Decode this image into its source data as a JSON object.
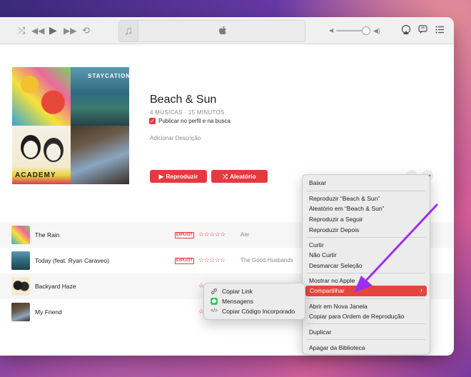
{
  "toolbar": {
    "shuffle_icon": "shuffle-icon",
    "prev_icon": "rewind-icon",
    "play_icon": "play-icon",
    "next_icon": "fast-forward-icon",
    "repeat_icon": "repeat-icon",
    "volume_level": 0.8,
    "airplay_icon": "airplay-icon",
    "lyrics_icon": "lyrics-icon",
    "queue_icon": "list-icon"
  },
  "playlist": {
    "title": "Beach & Sun",
    "meta": "4 MÚSICAS · 15 MINUTOS",
    "publish_label": "Publicar no perfil e na busca",
    "publish_checked": true,
    "add_description": "Adicionar Descrição",
    "play_label": "Reproduzir",
    "shuffle_label": "Aleatório",
    "cover_texts": [
      "STAYCATION",
      "ACADEMY"
    ]
  },
  "tracks": [
    {
      "name": "The Rain",
      "explicit": "EXPLICIT",
      "stars": "☆☆☆☆☆",
      "artist": "Aer"
    },
    {
      "name": "Today (feat. Ryan Caraveo)",
      "explicit": "EXPLICIT",
      "stars": "☆☆☆☆☆",
      "artist": "The Good Husbands"
    },
    {
      "name": "Backyard Haze",
      "explicit": "",
      "stars": "☆",
      "artist": ""
    },
    {
      "name": "My Friend",
      "explicit": "",
      "stars": "☆",
      "artist": ""
    }
  ],
  "context_menu": {
    "items": [
      "Baixar",
      "Reproduzir “Beach & Sun”",
      "Aleatório em “Beach & Sun”",
      "Reproduzir a Seguir",
      "Reproduzir Depois",
      "Curtir",
      "Não Curtir",
      "Desmarcar Seleção",
      "Mostrar no Apple",
      "Compartilhar",
      "Abrir em Nova Janela",
      "Copiar para Ordem de Reprodução",
      "Duplicar",
      "Apagar da Biblioteca"
    ],
    "highlighted": "Compartilhar",
    "highlight_color": "#e6453e"
  },
  "share_submenu": {
    "items": [
      {
        "label": "Copiar Link",
        "icon": "link-icon"
      },
      {
        "label": "Mensagens",
        "icon": "messages-icon"
      },
      {
        "label": "Copiar Código Incorporado",
        "icon": "code-icon"
      }
    ]
  },
  "colors": {
    "accent": "#e6393f",
    "annotation_arrow": "#9b2ff0"
  }
}
